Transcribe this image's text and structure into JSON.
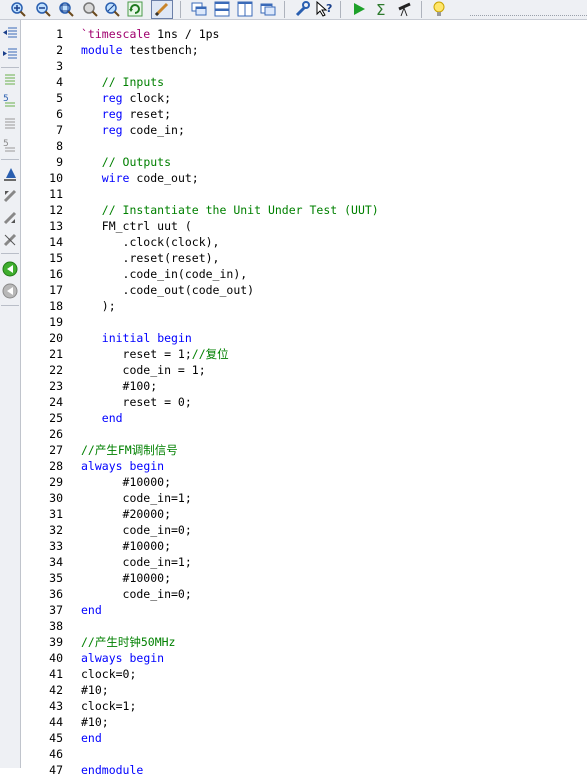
{
  "toolbar": {
    "buttons": [
      "zoom-in-icon",
      "zoom-out-icon",
      "zoom-fit-icon",
      "zoom-full-icon",
      "zoom-select-icon",
      "refresh-icon",
      "edit-mode-icon",
      "cascade-icon",
      "tile-horizontal-icon",
      "tile-vertical-icon",
      "window-icon",
      "wrench-icon",
      "help-pointer-icon",
      "run-icon",
      "sigma-icon",
      "telescope-icon",
      "lightbulb-icon"
    ]
  },
  "sidebar": {
    "buttons": [
      "indent-left-icon",
      "indent-right-icon",
      "comment-icon",
      "uncomment-icon",
      "bookmark-icon",
      "toggle-bookmark-icon",
      "next-bookmark-icon",
      "prev-bookmark-icon",
      "clear-bookmark-icon",
      "go-forward-icon",
      "go-back-icon"
    ]
  },
  "editor": {
    "line_numbers": [
      "1",
      "2",
      "3",
      "4",
      "5",
      "6",
      "7",
      "8",
      "9",
      "10",
      "11",
      "12",
      "13",
      "14",
      "15",
      "16",
      "17",
      "18",
      "19",
      "20",
      "21",
      "22",
      "23",
      "24",
      "25",
      "26",
      "27",
      "28",
      "29",
      "30",
      "31",
      "32",
      "33",
      "34",
      "35",
      "36",
      "37",
      "38",
      "39",
      "40",
      "41",
      "42",
      "43",
      "44",
      "45",
      "46",
      "47"
    ],
    "lines": [
      [
        [
          "pp",
          "`timescale"
        ],
        [
          "tx",
          " 1ns / 1ps"
        ]
      ],
      [
        [
          "kw",
          "module"
        ],
        [
          "tx",
          " testbench;"
        ]
      ],
      [],
      [
        [
          "tx",
          "   "
        ],
        [
          "cm",
          "// Inputs"
        ]
      ],
      [
        [
          "tx",
          "   "
        ],
        [
          "kw",
          "reg"
        ],
        [
          "tx",
          " clock;"
        ]
      ],
      [
        [
          "tx",
          "   "
        ],
        [
          "kw",
          "reg"
        ],
        [
          "tx",
          " reset;"
        ]
      ],
      [
        [
          "tx",
          "   "
        ],
        [
          "kw",
          "reg"
        ],
        [
          "tx",
          " code_in;"
        ]
      ],
      [],
      [
        [
          "tx",
          "   "
        ],
        [
          "cm",
          "// Outputs"
        ]
      ],
      [
        [
          "tx",
          "   "
        ],
        [
          "kw",
          "wire"
        ],
        [
          "tx",
          " code_out;"
        ]
      ],
      [],
      [
        [
          "tx",
          "   "
        ],
        [
          "cm",
          "// Instantiate the Unit Under Test (UUT)"
        ]
      ],
      [
        [
          "tx",
          "   FM_ctrl uut ("
        ]
      ],
      [
        [
          "tx",
          "      .clock(clock),"
        ]
      ],
      [
        [
          "tx",
          "      .reset(reset),"
        ]
      ],
      [
        [
          "tx",
          "      .code_in(code_in),"
        ]
      ],
      [
        [
          "tx",
          "      .code_out(code_out)"
        ]
      ],
      [
        [
          "tx",
          "   );"
        ]
      ],
      [],
      [
        [
          "tx",
          "   "
        ],
        [
          "kw",
          "initial"
        ],
        [
          "tx",
          " "
        ],
        [
          "kw",
          "begin"
        ]
      ],
      [
        [
          "tx",
          "      reset = 1;"
        ],
        [
          "cm",
          "//复位"
        ]
      ],
      [
        [
          "tx",
          "      code_in = 1;"
        ]
      ],
      [
        [
          "tx",
          "      #100;"
        ]
      ],
      [
        [
          "tx",
          "      reset = 0;"
        ]
      ],
      [
        [
          "tx",
          "   "
        ],
        [
          "kw",
          "end"
        ]
      ],
      [],
      [
        [
          "cm",
          "//产生FM调制信号"
        ]
      ],
      [
        [
          "kw",
          "always"
        ],
        [
          "tx",
          " "
        ],
        [
          "kw",
          "begin"
        ]
      ],
      [
        [
          "tx",
          "      #10000;"
        ]
      ],
      [
        [
          "tx",
          "      code_in=1;"
        ]
      ],
      [
        [
          "tx",
          "      #20000;"
        ]
      ],
      [
        [
          "tx",
          "      code_in=0;"
        ]
      ],
      [
        [
          "tx",
          "      #10000;"
        ]
      ],
      [
        [
          "tx",
          "      code_in=1;"
        ]
      ],
      [
        [
          "tx",
          "      #10000;"
        ]
      ],
      [
        [
          "tx",
          "      code_in=0;"
        ]
      ],
      [
        [
          "kw",
          "end"
        ]
      ],
      [],
      [
        [
          "cm",
          "//产生时钟50MHz"
        ]
      ],
      [
        [
          "kw",
          "always"
        ],
        [
          "tx",
          " "
        ],
        [
          "kw",
          "begin"
        ]
      ],
      [
        [
          "tx",
          "clock=0;"
        ]
      ],
      [
        [
          "tx",
          "#10;"
        ]
      ],
      [
        [
          "tx",
          "clock=1;"
        ]
      ],
      [
        [
          "tx",
          "#10;"
        ]
      ],
      [
        [
          "kw",
          "end"
        ]
      ],
      [],
      [
        [
          "kw",
          "endmodule"
        ]
      ]
    ]
  },
  "colors": {
    "keyword": "#0000ff",
    "comment": "#008000",
    "directive": "#a0006e"
  }
}
